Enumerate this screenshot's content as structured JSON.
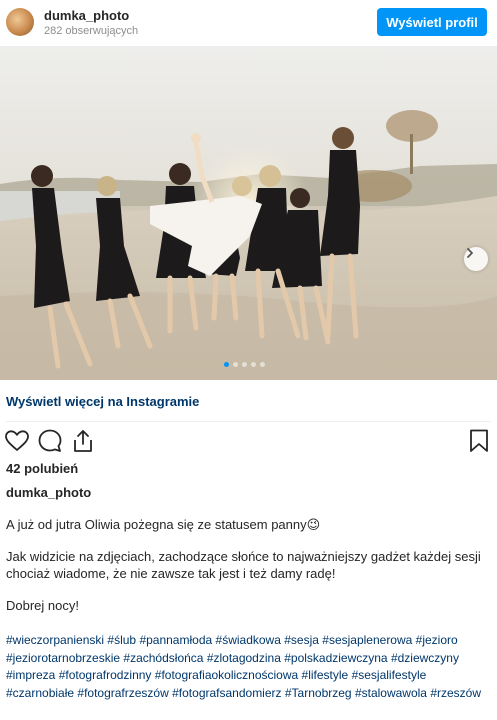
{
  "header": {
    "username": "dumka_photo",
    "followers": "282 obserwujących",
    "profile_button": "Wyświetl profil"
  },
  "post": {
    "image_alt": "Group of women in black dresses lifting a bride in white on a sandy beach",
    "carousel_dots": 5,
    "active_dot": 1,
    "view_more": "Wyświetl więcej na Instagramie",
    "likes": "42 polubień",
    "author": "dumka_photo",
    "caption": {
      "line1": "A już od jutra Oliwia pożegna się ze statusem panny😉",
      "line2": "Jak widzicie na zdjęciach, zachodzące słońce to najważniejszy gadżet każdej sesji chociaż wiadome, że nie zawsze tak jest i też damy radę!",
      "line3": "Dobrej nocy!"
    },
    "hashtags": [
      "#wieczorpanienski",
      "#ślub",
      "#pannamłoda",
      "#świadkowa",
      "#sesja",
      "#sesjaplenerowa",
      "#jezioro",
      "#jeziorotarnobrzeskie",
      "#zachódsłońca",
      "#zlotagodzina",
      "#polskadziewczyna",
      "#dziewczyny",
      "#impreza",
      "#fotografrodzinny",
      "#fotografiaokolicznościowa",
      "#lifestyle",
      "#sesjalifestyle",
      "#czarnobiałe",
      "#fotografrzeszów",
      "#fotografsandomierz",
      "#Tarnobrzeg",
      "#stalowawola",
      "#rzeszów"
    ]
  },
  "icons": {
    "like": "heart-icon",
    "comment": "comment-icon",
    "share": "share-icon",
    "save": "bookmark-icon",
    "next": "chevron-right-icon"
  },
  "colors": {
    "button": "#0095f6",
    "link": "#00376b",
    "muted": "#8e8e8e"
  }
}
